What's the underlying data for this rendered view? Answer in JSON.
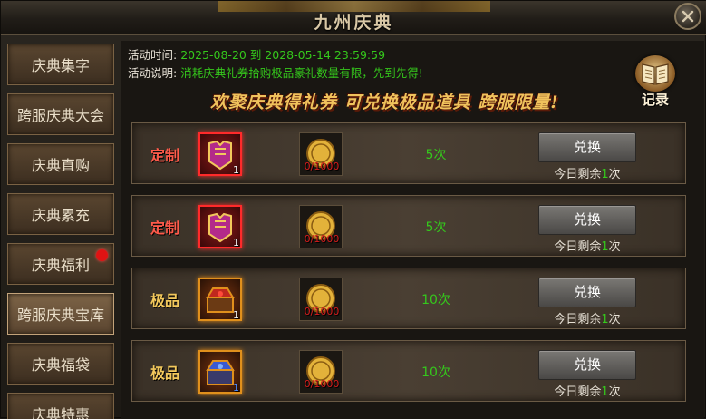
{
  "window": {
    "title": "九州庆典"
  },
  "sidebar": {
    "items": [
      {
        "label": "庆典集字",
        "active": false,
        "badge": false
      },
      {
        "label": "跨服庆典大会",
        "active": false,
        "badge": false
      },
      {
        "label": "庆典直购",
        "active": false,
        "badge": false
      },
      {
        "label": "庆典累充",
        "active": false,
        "badge": false
      },
      {
        "label": "庆典福利",
        "active": false,
        "badge": true
      },
      {
        "label": "跨服庆典宝库",
        "active": true,
        "badge": false
      },
      {
        "label": "庆典福袋",
        "active": false,
        "badge": false
      },
      {
        "label": "庆典特惠",
        "active": false,
        "badge": false
      }
    ]
  },
  "info": {
    "time_label": "活动时间:",
    "time_value": "2025-08-20 到 2028-05-14 23:59:59",
    "desc_label": "活动说明:",
    "desc_value": "消耗庆典礼券拾购极品豪礼数量有限，先到先得!"
  },
  "slogan": "欢聚庆典得礼券 可兑换极品道具 跨服限量!",
  "record_button": {
    "label": "记录",
    "icon": "book-icon"
  },
  "rows": [
    {
      "tier": "定制",
      "tier_color": "#ff5a4a",
      "item_count": "1",
      "coin_value": "0/1000",
      "times": "5次",
      "button_label": "兑换",
      "remain_prefix": "今日剩余",
      "remain_count": "1",
      "remain_suffix": "次"
    },
    {
      "tier": "定制",
      "tier_color": "#ff5a4a",
      "item_count": "1",
      "coin_value": "0/1000",
      "times": "5次",
      "button_label": "兑换",
      "remain_prefix": "今日剩余",
      "remain_count": "1",
      "remain_suffix": "次"
    },
    {
      "tier": "极品",
      "tier_color": "#f2c85c",
      "item_count": "1",
      "coin_value": "0/1000",
      "times": "10次",
      "button_label": "兑换",
      "remain_prefix": "今日剩余",
      "remain_count": "1",
      "remain_suffix": "次"
    },
    {
      "tier": "极品",
      "tier_color": "#f2c85c",
      "item_count": "1",
      "coin_value": "0/1000",
      "times": "10次",
      "button_label": "兑换",
      "remain_prefix": "今日剩余",
      "remain_count": "1",
      "remain_suffix": "次"
    }
  ]
}
